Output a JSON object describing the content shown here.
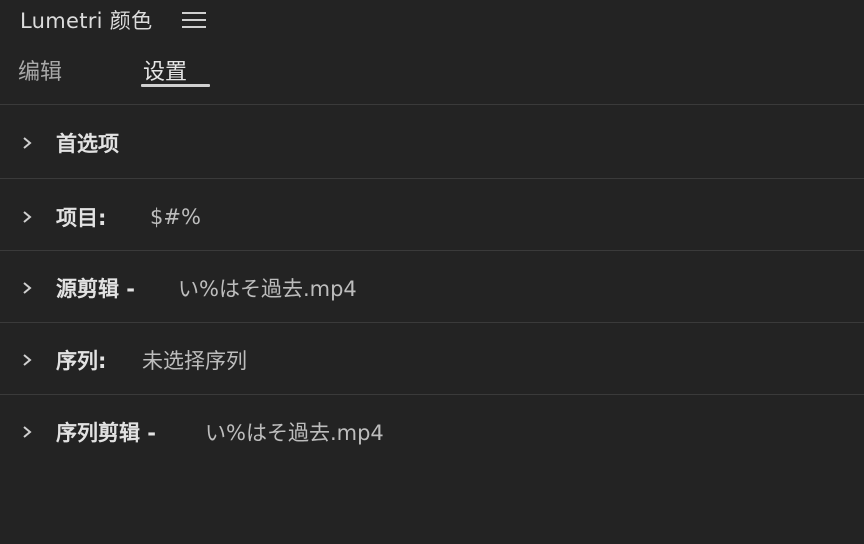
{
  "panel": {
    "title": "Lumetri 颜色",
    "menu_icon": "hamburger-menu-icon"
  },
  "tabs": [
    {
      "label": "编辑",
      "active": false
    },
    {
      "label": "设置",
      "active": true
    }
  ],
  "sections": [
    {
      "label": "首选项",
      "value": ""
    },
    {
      "label": "项目:",
      "value": "$#%"
    },
    {
      "label": "源剪辑 -",
      "value": "い%はそ過去.mp4"
    },
    {
      "label": "序列:",
      "value": "未选择序列"
    },
    {
      "label": "序列剪辑 -",
      "value": "い%はそ過去.mp4"
    }
  ],
  "icons": {
    "expand": "chevron-right-icon"
  },
  "colors": {
    "background": "#232323",
    "divider": "#3a3a3a",
    "text_primary": "#e2e2e2",
    "text_secondary": "#bdbdbd"
  }
}
